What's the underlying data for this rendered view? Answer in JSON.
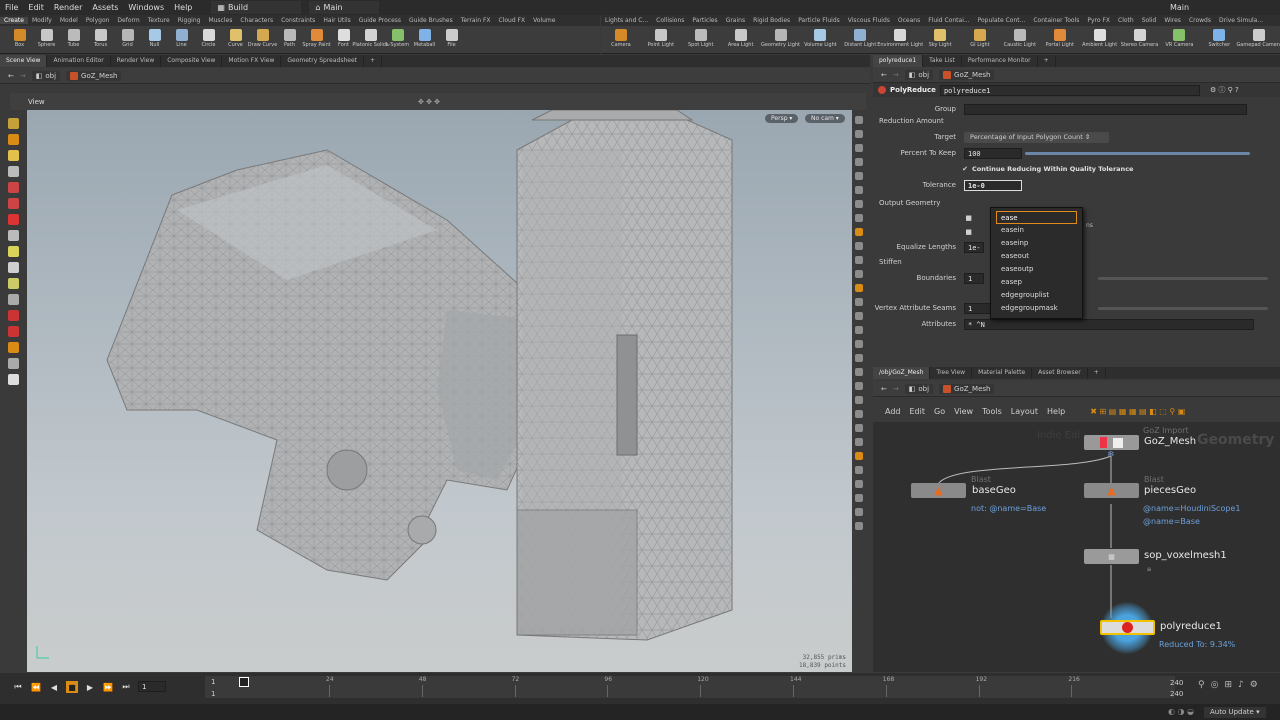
{
  "menubar": {
    "items": [
      "File",
      "Edit",
      "Render",
      "Assets",
      "Windows",
      "Help"
    ],
    "desktop": "Build",
    "context": "Main",
    "right_context": "Main"
  },
  "shelf_left": {
    "tabs": [
      "Create",
      "Modify",
      "Model",
      "Polygon",
      "Deform",
      "Texture",
      "Rigging",
      "Muscles",
      "Characters",
      "Constraints",
      "Hair Utils",
      "Guide Process",
      "Guide Brushes",
      "Terrain FX",
      "Cloud FX",
      "Volume"
    ],
    "tools": [
      "Box",
      "Sphere",
      "Tube",
      "Torus",
      "Grid",
      "Null",
      "Line",
      "Circle",
      "Curve",
      "Draw Curve",
      "Path",
      "Spray Paint",
      "Font",
      "Platonic Solids",
      "L-System",
      "Metaball",
      "File"
    ]
  },
  "shelf_right": {
    "tabs": [
      "Lights and C...",
      "Collisions",
      "Particles",
      "Grains",
      "Rigid Bodies",
      "Particle Fluids",
      "Viscous Fluids",
      "Oceans",
      "Fluid Contai...",
      "Populate Cont...",
      "Container Tools",
      "Pyro FX",
      "Cloth",
      "Solid",
      "Wires",
      "Crowds",
      "Drive Simula..."
    ],
    "tools": [
      "Camera",
      "Point Light",
      "Spot Light",
      "Area Light",
      "Geometry Light",
      "Volume Light",
      "Distant Light",
      "Environment Light",
      "Sky Light",
      "GI Light",
      "Caustic Light",
      "Portal Light",
      "Ambient Light",
      "Stereo Camera",
      "VR Camera",
      "Switcher",
      "Gamepad Camera"
    ]
  },
  "left_pane": {
    "tabs": [
      "Scene View",
      "Animation Editor",
      "Render View",
      "Composite View",
      "Motion FX View",
      "Geometry Spreadsheet"
    ],
    "path": [
      "obj",
      "GoZ_Mesh"
    ],
    "view_label": "View",
    "persp": "Persp",
    "cam": "No cam",
    "stats": {
      "prims_value": "32,855",
      "prims_label": "prims",
      "points_value": "18,839",
      "points_label": "points"
    }
  },
  "param_pane": {
    "tabs": [
      "polyreduce1",
      "Take List",
      "Performance Monitor"
    ],
    "path": [
      "obj",
      "GoZ_Mesh"
    ],
    "node_type": "PolyReduce",
    "node_name": "polyreduce1",
    "group_label": "Group",
    "section_reduction": "Reduction Amount",
    "target_label": "Target",
    "target_value": "Percentage of Input Polygon Count",
    "percent_label": "Percent To Keep",
    "percent_value": "100",
    "continue_label": "Continue Reducing Within Quality Tolerance",
    "tolerance_label": "Tolerance",
    "tolerance_value": "1e-0",
    "section_output": "Output Geometry",
    "equalize_label": "Equalize Lengths",
    "equalize_value": "1e-1",
    "section_stiffen": "Stiffen",
    "boundaries_label": "Boundaries",
    "boundaries_value": "1",
    "vertex_label": "Vertex Attribute Seams",
    "vertex_value": "1",
    "attributes_label": "Attributes",
    "attributes_value": "* ^N",
    "hidden_snippet": "ns",
    "autocomplete": [
      "ease",
      "easein",
      "easeinp",
      "easeout",
      "easeoutp",
      "easep",
      "edgegrouplist",
      "edgegroupmask"
    ]
  },
  "network_pane": {
    "tabs": [
      "/obj/GoZ_Mesh",
      "Tree View",
      "Material Palette",
      "Asset Browser"
    ],
    "path": [
      "obj",
      "GoZ_Mesh"
    ],
    "menu": [
      "Add",
      "Edit",
      "Go",
      "View",
      "Tools",
      "Layout",
      "Help"
    ],
    "watermark_left": "Indie Edi",
    "watermark_right": "Geometry",
    "nodes": {
      "goz": {
        "type": "GoZ Import",
        "name": "GoZ_Mesh"
      },
      "base": {
        "type": "Blast",
        "name": "baseGeo",
        "note": "not: @name=Base"
      },
      "pieces": {
        "type": "Blast",
        "name": "piecesGeo",
        "note1": "@name=HoudiniScope1",
        "note2": "@name=Base"
      },
      "voxel": {
        "name": "sop_voxelmesh1"
      },
      "poly": {
        "name": "polyreduce1",
        "note": "Reduced To: 9.34%"
      }
    }
  },
  "timeline": {
    "frame": "1",
    "start": "1",
    "start2": "1",
    "ticks": [
      "24",
      "48",
      "72",
      "96",
      "120",
      "144",
      "168",
      "192",
      "216"
    ],
    "end": "240",
    "end2": "240",
    "auto_update": "Auto Update"
  }
}
